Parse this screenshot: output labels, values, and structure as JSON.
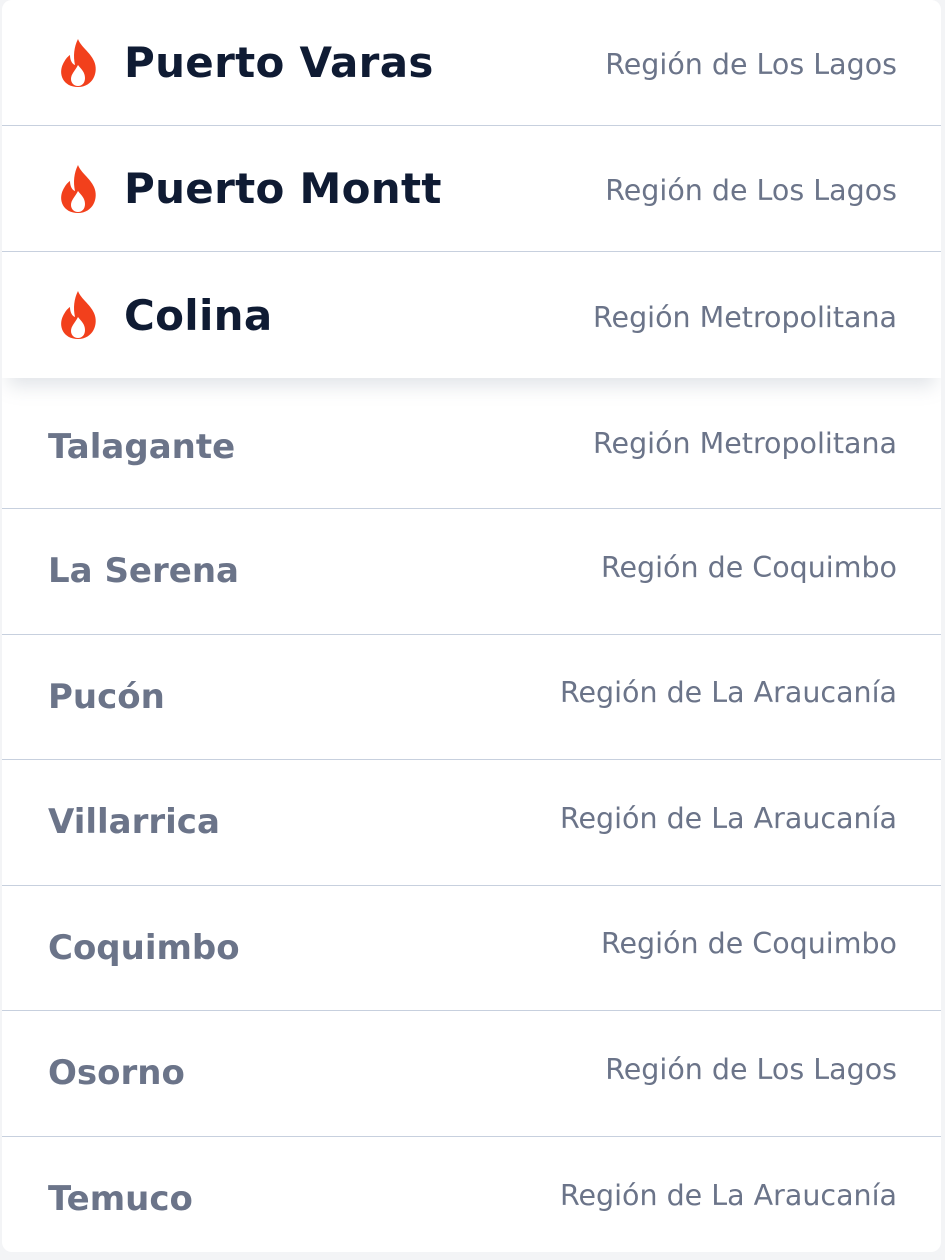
{
  "featured": [
    {
      "name": "Puerto Varas",
      "region": "Región de Los Lagos",
      "icon": "fire-icon"
    },
    {
      "name": "Puerto Montt",
      "region": "Región de Los Lagos",
      "icon": "fire-icon"
    },
    {
      "name": "Colina",
      "region": "Región Metropolitana",
      "icon": "fire-icon"
    }
  ],
  "results": [
    {
      "name": "Talagante",
      "region": "Región Metropolitana"
    },
    {
      "name": "La Serena",
      "region": "Región de Coquimbo"
    },
    {
      "name": "Pucón",
      "region": "Región de La Araucanía"
    },
    {
      "name": "Villarrica",
      "region": "Región de La Araucanía"
    },
    {
      "name": "Coquimbo",
      "region": "Región de Coquimbo"
    },
    {
      "name": "Osorno",
      "region": "Región de Los Lagos"
    },
    {
      "name": "Temuco",
      "region": "Región de La Araucanía"
    }
  ],
  "colors": {
    "fire": "#f2401c",
    "hot_text": "#0f1b33",
    "muted_text": "#6b7489",
    "divider": "#c7d0de"
  }
}
